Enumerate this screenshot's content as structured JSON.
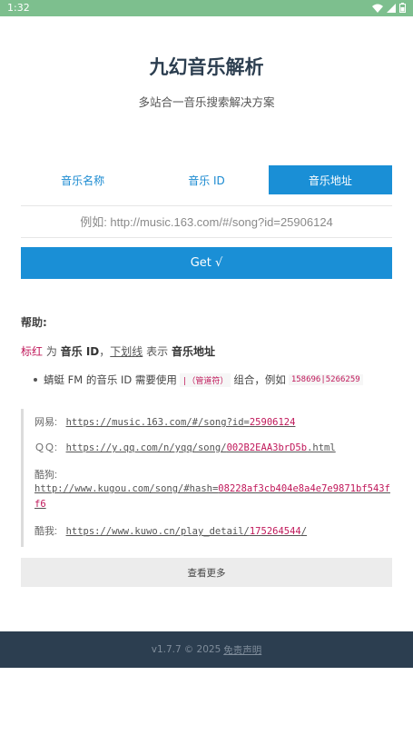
{
  "status_bar": {
    "time": "1:32",
    "icons": [
      "wifi-icon",
      "signal-icon",
      "battery-icon"
    ]
  },
  "header": {
    "title": "九幻音乐解析",
    "subtitle": "多站合一音乐搜索解决方案"
  },
  "tabs": [
    {
      "label": "音乐名称",
      "active": false
    },
    {
      "label": "音乐 ID",
      "active": false
    },
    {
      "label": "音乐地址",
      "active": true
    }
  ],
  "search": {
    "placeholder": "例如: http://music.163.com/#/song?id=25906124",
    "value": ""
  },
  "get_button": {
    "label": "Get √"
  },
  "help": {
    "title": "帮助:",
    "legend": {
      "red_word": "标红",
      "t1": " 为 ",
      "bold1": "音乐 ID",
      "t2": "，",
      "underline_word": "下划线",
      "t3": " 表示 ",
      "bold2": "音乐地址"
    },
    "note": {
      "text1": "蜻蜓 FM 的音乐 ID 需要使用",
      "code1": "|（管道符）",
      "text2": "组合，例如",
      "code2": "158696|5266259"
    }
  },
  "examples": [
    {
      "label": "网易:",
      "url_prefix": "https://music.163.com/#/song?id=",
      "url_id": "25906124",
      "url_suffix": ""
    },
    {
      "label": "ＱＱ:",
      "url_prefix": "https://y.qq.com/n/yqq/song/",
      "url_id": "002B2EAA3brD5b",
      "url_suffix": ".html"
    },
    {
      "label": "酷狗:",
      "url_prefix": "http://www.kugou.com/song/#hash=",
      "url_id": "08228af3cb404e8a4e7e9871bf543ff6",
      "url_suffix": ""
    },
    {
      "label": "酷我:",
      "url_prefix": "https://www.kuwo.cn/play_detail/",
      "url_id": "175264544",
      "url_suffix": "/"
    }
  ],
  "more_button": {
    "label": "查看更多"
  },
  "footer": {
    "version": "v1.7.7",
    "copyright": "© 2025",
    "disclaimer": "免责声明"
  },
  "colors": {
    "accent": "#1a8fd6",
    "highlight": "#c0185a",
    "footer_bg": "#2c3e50",
    "status_bar": "#7dbf8e"
  }
}
